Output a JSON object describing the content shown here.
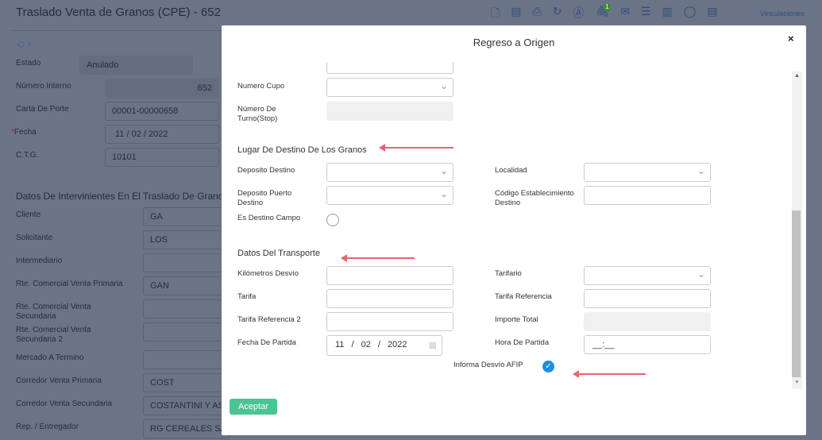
{
  "background": {
    "title": "Traslado Venta de Granos (CPE) - 652",
    "toolbar_link": "Vinculaciones",
    "badge": "1",
    "fields": [
      {
        "label": "Estado",
        "value": "Anulado"
      },
      {
        "label": "Número Interno",
        "value": "652"
      },
      {
        "label": "Carta De Porte",
        "value": "00001-00000658"
      },
      {
        "label": "Fecha",
        "value": "11  /  02  /  2022",
        "required": "*"
      },
      {
        "label": "C.T.G.",
        "value": "10101"
      }
    ],
    "section": "Datos De Intervinientes En El Traslado De Granos",
    "parties": [
      {
        "label": "Cliente",
        "value": "GA"
      },
      {
        "label": "Solicitante",
        "value": "LOS"
      },
      {
        "label": "Intermediario",
        "value": ""
      },
      {
        "label": "Rte. Comercial Venta Primaria",
        "value": "GAN"
      },
      {
        "label": "Rte. Comercial Venta Secundaria",
        "value": ""
      },
      {
        "label": "Rte. Comercial Venta Secundaria 2",
        "value": ""
      },
      {
        "label": "Mercado A Termino",
        "value": ""
      },
      {
        "label": "Corredor Venta Primaria",
        "value": "COST"
      },
      {
        "label": "Corredor Venta Secundaria",
        "value": "COSTANTINI Y AS"
      },
      {
        "label": "Rep. / Entregador",
        "value": "RG CEREALES SA"
      }
    ]
  },
  "modal": {
    "title": "Regreso a Origen",
    "close": "×",
    "numero_cupo": "Numero Cupo",
    "numero_turno": "Número De Turno(Stop)",
    "section_destino": "Lugar De Destino De Los Granos",
    "deposito_destino": "Deposito Destino",
    "localidad": "Localidad",
    "deposito_puerto": "Deposito Puerto Destino",
    "codigo_establecimiento": "Código Establecimiento Destino",
    "es_destino_campo": "Es Destino Campo",
    "section_transporte": "Datos Del Transporte",
    "km_desvio": "Kilómetros Desvío",
    "tarifario": "Tarifario",
    "tarifa": "Tarifa",
    "tarifa_referencia": "Tarifa Referencia",
    "tarifa_referencia_2": "Tarifa Referencia 2",
    "importe_total": "Importe Total",
    "fecha_partida": "Fecha De Partida",
    "fecha_partida_value": "11 / 02 / 2022",
    "hora_partida": "Hora De Partida",
    "hora_partida_value": "__:__",
    "informa_desvio": "Informa Desvío AFIP",
    "informa_desvio_checked": true,
    "accept": "Aceptar"
  },
  "colors": {
    "accent": "#4cc491",
    "annotation": "#f06070",
    "check": "#1a8fe0"
  }
}
